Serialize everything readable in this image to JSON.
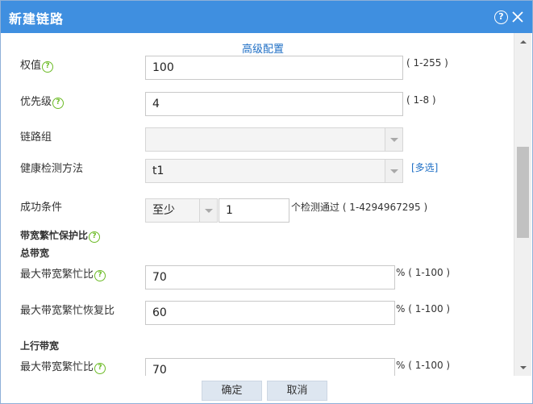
{
  "dialog": {
    "title": "新建链路",
    "help_glyph": "?"
  },
  "advanced": {
    "label": "高级配置"
  },
  "form": {
    "weight": {
      "label": "权值",
      "value": "100",
      "hint": "( 1-255 )"
    },
    "priority": {
      "label": "优先级",
      "value": "4",
      "hint": "( 1-8 )"
    },
    "link_group": {
      "label": "链路组",
      "value": ""
    },
    "health_check": {
      "label": "健康检测方法",
      "value": "t1",
      "multi_label": "[多选]"
    },
    "success": {
      "label": "成功条件",
      "mode": "至少",
      "count": "1",
      "hint": "个检测通过 ( 1-4294967295 )"
    },
    "busy_ratio": {
      "label": "带宽繁忙保护比"
    },
    "total_bw": {
      "label": "总带宽",
      "max_busy": {
        "label": "最大带宽繁忙比",
        "value": "70",
        "hint": "% ( 1-100 )"
      },
      "max_recover": {
        "label": "最大带宽繁忙恢复比",
        "value": "60",
        "hint": "% ( 1-100 )"
      }
    },
    "up_bw": {
      "label": "上行带宽",
      "max_busy": {
        "label": "最大带宽繁忙比",
        "value": "70",
        "hint": "% ( 1-100 )"
      }
    }
  },
  "footer": {
    "ok_label": "确定",
    "cancel_label": "取消"
  },
  "colors": {
    "titlebar": "#3f8fe0",
    "link": "#1f6fc5",
    "help_icon": "#6cbb26",
    "button": "#dde6f0"
  }
}
